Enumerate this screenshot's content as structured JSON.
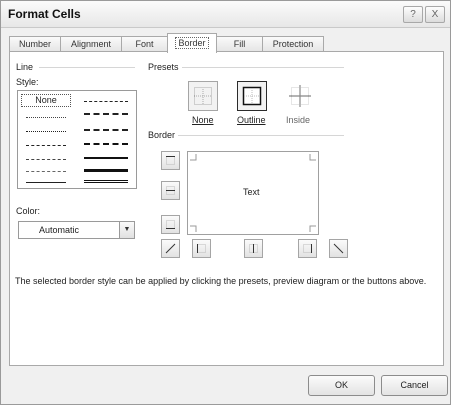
{
  "window": {
    "title": "Format Cells",
    "help_glyph": "?",
    "close_glyph": "X"
  },
  "tabs": [
    "Number",
    "Alignment",
    "Font",
    "Border",
    "Fill",
    "Protection"
  ],
  "active_tab": "Border",
  "line_group": {
    "title": "Line",
    "style_label": "Style:",
    "none_label": "None",
    "color_label": "Color:",
    "color_value": "Automatic"
  },
  "presets": {
    "title": "Presets",
    "items": [
      {
        "label": "None",
        "icon": "preset-none-icon"
      },
      {
        "label": "Outline",
        "icon": "preset-outline-icon"
      },
      {
        "label": "Inside",
        "icon": "preset-inside-icon"
      }
    ]
  },
  "border_group": {
    "title": "Border",
    "preview_text": "Text"
  },
  "hint_text": "The selected border style can be applied by clicking the presets, preview diagram or the buttons above.",
  "buttons": {
    "ok": "OK",
    "cancel": "Cancel"
  },
  "colors": {
    "dialog_bg": "#f0f0f0",
    "panel_bg": "#ffffff",
    "border": "#a9a9a9",
    "selected_preset": "#2b2b2b"
  }
}
